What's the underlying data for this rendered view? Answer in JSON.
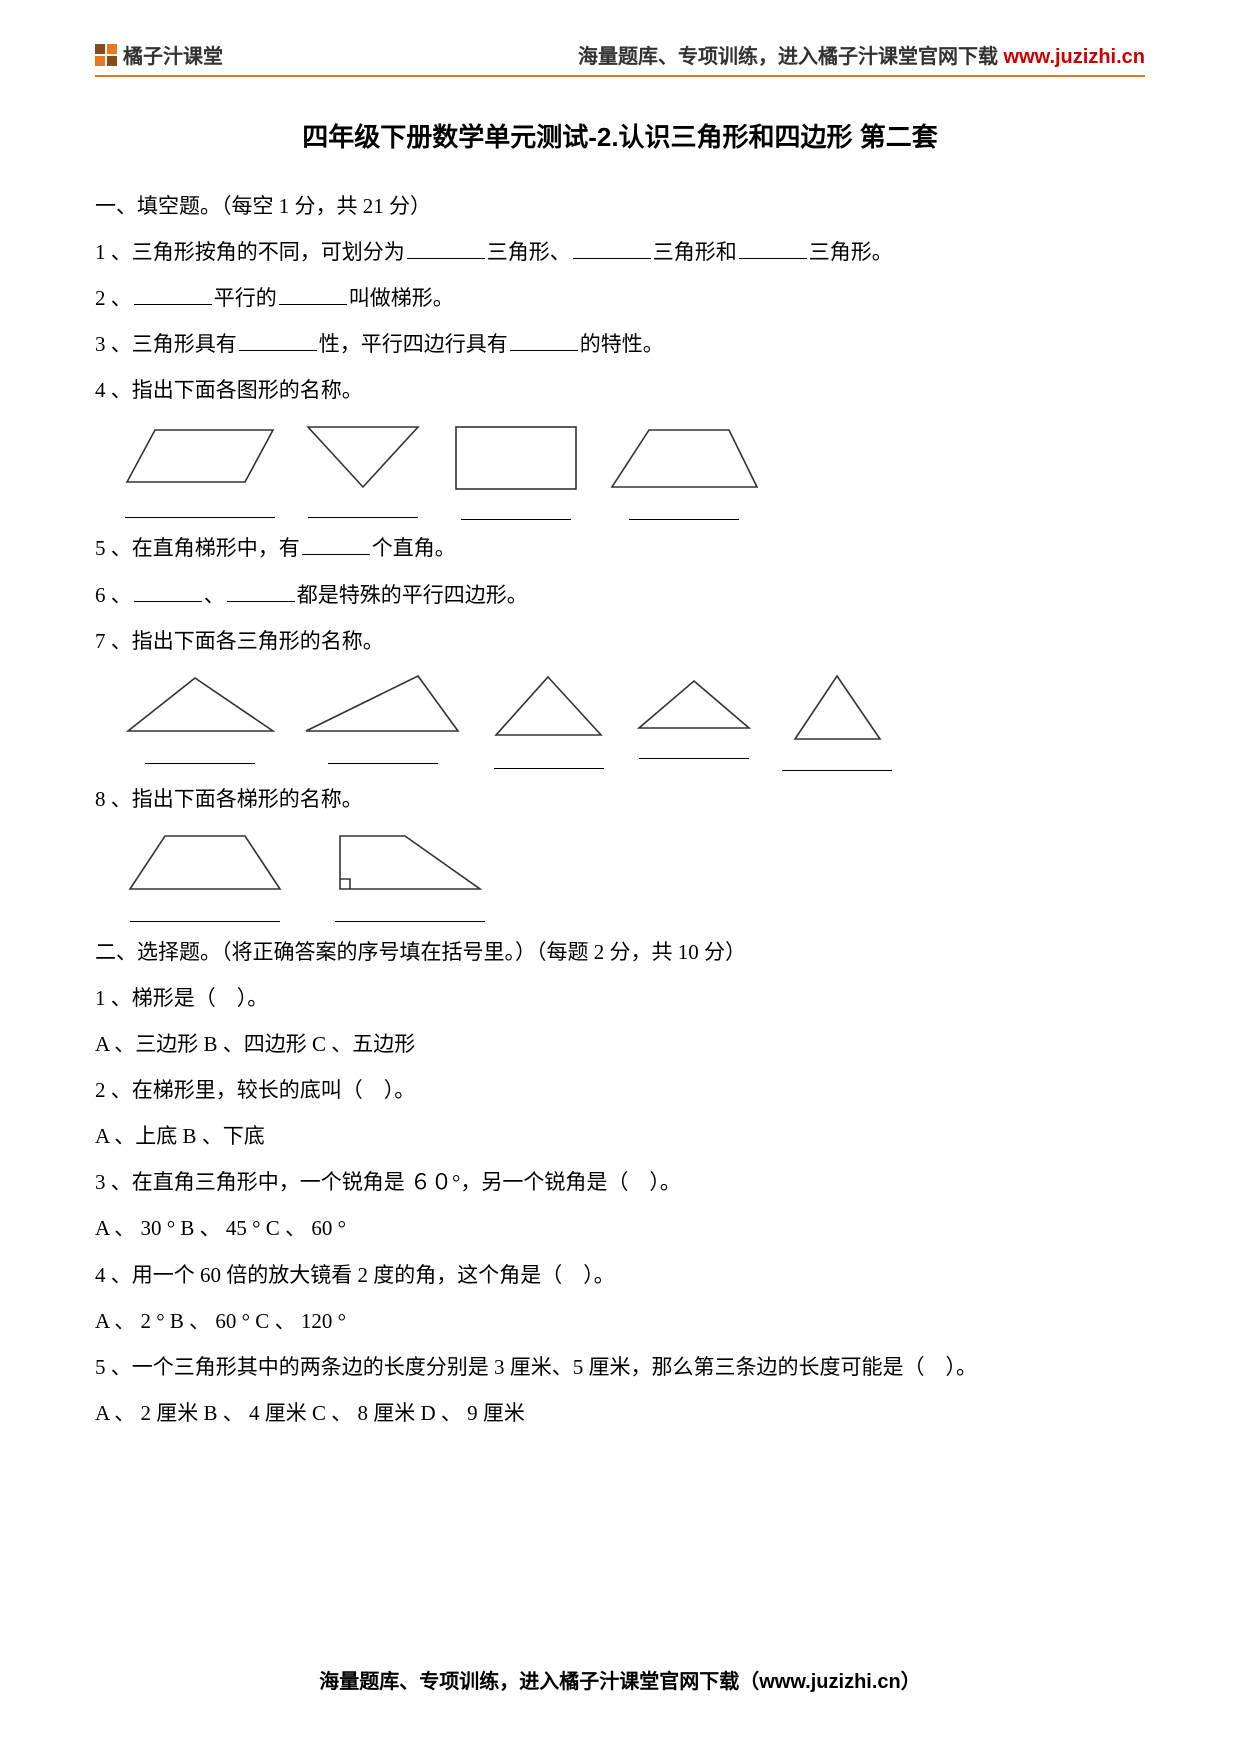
{
  "header": {
    "brand": "橘子汁课堂",
    "tagline_prefix": "海量题库、专项训练，进入橘子汁课堂官网下载 ",
    "domain": "www.juzizhi.cn"
  },
  "title": "四年级下册数学单元测试-2.认识三角形和四边形  第二套",
  "s1": {
    "heading": "一、填空题。（每空 1 分，共 21 分）",
    "q1_a": "1 、三角形按角的不同，可划分为",
    "q1_b": "三角形、",
    "q1_c": "三角形和",
    "q1_d": "三角形。",
    "q2_a": "2 、",
    "q2_b": "平行的",
    "q2_c": "叫做梯形。",
    "q3_a": "3 、三角形具有",
    "q3_b": "性，平行四边行具有",
    "q3_c": "的特性。",
    "q4": "4 、指出下面各图形的名称。",
    "q5_a": "5 、在直角梯形中，有",
    "q5_b": "个直角。",
    "q6_a": "6 、",
    "q6_b": "、",
    "q6_c": "都是特殊的平行四边形。",
    "q7": "7 、指出下面各三角形的名称。",
    "q8": "8 、指出下面各梯形的名称。"
  },
  "s2": {
    "heading": "二、选择题。（将正确答案的序号填在括号里。）（每题 2 分，共 10 分）",
    "q1": "1 、梯形是（　）。",
    "q1o": " A 、三边形   B 、四边形   C 、五边形",
    "q2": "2 、在梯形里，较长的底叫（　）。",
    "q2o": " A 、上底   B 、下底",
    "q3": "3 、在直角三角形中，一个锐角是 ６０°，另一个锐角是（　）。",
    "q3o": " A 、 30 °   B 、 45 °   C 、 60 °",
    "q4": "4 、用一个 60 倍的放大镜看 2 度的角，这个角是（　）。",
    "q4o": " A 、 2 °   B 、 60 °   C 、 120 °",
    "q5": "5  、一个三角形其中的两条边的长度分别是 3 厘米、5 厘米，那么第三条边的长度可能是（　）。",
    "q5o": " A 、 2 厘米   B 、 4 厘米   C 、 8 厘米   D 、 9 厘米"
  },
  "footer_a": "海量题库、专项训练，进入橘子汁课堂官网下载（",
  "footer_b": "www.juzizhi.cn",
  "footer_c": "）"
}
